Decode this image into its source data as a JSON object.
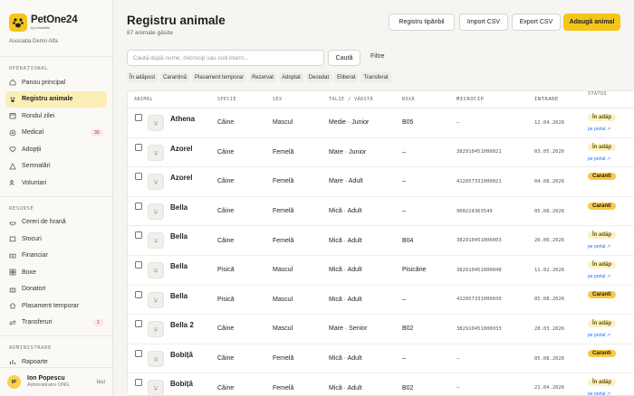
{
  "brand": {
    "name": "PetOne24",
    "sub": "by fundatiile"
  },
  "org": "Asociația Demo Alfa",
  "sidebar": {
    "sections": [
      {
        "label": "OPERAȚIONAL",
        "items": [
          {
            "label": "Panou principal",
            "icon": "home-icon"
          },
          {
            "label": "Registru animale",
            "icon": "paw-icon",
            "active": true
          },
          {
            "label": "Rondul zilei",
            "icon": "calendar-icon"
          },
          {
            "label": "Medical",
            "icon": "medical-icon",
            "badge": "36"
          },
          {
            "label": "Adopții",
            "icon": "heart-icon"
          },
          {
            "label": "Semnalări",
            "icon": "alert-icon"
          },
          {
            "label": "Voluntari",
            "icon": "users-icon"
          }
        ]
      },
      {
        "label": "RESURSE",
        "items": [
          {
            "label": "Cereri de hrană",
            "icon": "food-icon"
          },
          {
            "label": "Stocuri",
            "icon": "box-icon"
          },
          {
            "label": "Financiar",
            "icon": "money-icon"
          },
          {
            "label": "Boxe",
            "icon": "grid-icon"
          },
          {
            "label": "Donatori",
            "icon": "gift-icon"
          },
          {
            "label": "Plasament temporar",
            "icon": "house-icon"
          },
          {
            "label": "Transferuri",
            "icon": "transfer-icon",
            "badge": "1"
          }
        ]
      },
      {
        "label": "ADMINISTRARE",
        "items": [
          {
            "label": "Rapoarte",
            "icon": "chart-icon"
          }
        ]
      }
    ]
  },
  "user": {
    "initials": "IP",
    "name": "Ion Popescu",
    "role": "Administrator ONG",
    "logout": "Ieși"
  },
  "header": {
    "title": "Registru animale",
    "subtitle": "87 animale găsite",
    "buttons": {
      "print": "Registru tipăribil",
      "import": "Import CSV",
      "export": "Export CSV",
      "add": "Adaugă animal"
    }
  },
  "search": {
    "placeholder": "Caută după nume, microcip sau cod intern...",
    "button": "Caută",
    "filter": "Filtre"
  },
  "chips": [
    "În adăpost",
    "Carantină",
    "Plasament temporar",
    "Rezervat",
    "Adoptat",
    "Decedat",
    "Eliberat",
    "Transferat"
  ],
  "table": {
    "headers": [
      "ANIMAL",
      "SPECIE",
      "SEX",
      "TALIE / VÂRSTĂ",
      "BOXĂ",
      "MICROCIP",
      "INTRARE",
      "STATUS"
    ],
    "rows": [
      {
        "name": "Athena",
        "specie": "Câine",
        "sex": "Mascul",
        "talie": "Medie · Junior",
        "boxa": "B05",
        "microcip": "–",
        "intrare": "12.04.2026",
        "status": "În adăp",
        "status_type": "adapost",
        "portal": "pe portal ↗"
      },
      {
        "name": "Azorel",
        "specie": "Câine",
        "sex": "Femelă",
        "talie": "Mare · Junior",
        "boxa": "–",
        "microcip": "382910451000021",
        "intrare": "03.05.2026",
        "status": "În adăp",
        "status_type": "adapost",
        "portal": "pe portal ↗"
      },
      {
        "name": "Azorel",
        "specie": "Câine",
        "sex": "Femelă",
        "talie": "Mare · Adult",
        "boxa": "–",
        "microcip": "412057331000021",
        "intrare": "04.08.2026",
        "status": "Caranti",
        "status_type": "carantina",
        "portal": ""
      },
      {
        "name": "Bella",
        "specie": "Câine",
        "sex": "Femelă",
        "talie": "Mică · Adult",
        "boxa": "–",
        "microcip": "900224363549",
        "intrare": "05.08.2026",
        "status": "Caranti",
        "status_type": "carantina",
        "portal": ""
      },
      {
        "name": "Bella",
        "specie": "Câine",
        "sex": "Femelă",
        "talie": "Mică · Adult",
        "boxa": "B04",
        "microcip": "382910451000003",
        "intrare": "26.06.2026",
        "status": "În adăp",
        "status_type": "adapost",
        "portal": "pe portal ↗"
      },
      {
        "name": "Bella",
        "specie": "Pisică",
        "sex": "Mascul",
        "talie": "Mică · Adult",
        "boxa": "Pisicărie",
        "microcip": "382910451000048",
        "intrare": "11.02.2026",
        "status": "În adăp",
        "status_type": "adapost",
        "portal": "pe portal ↗"
      },
      {
        "name": "Bella",
        "specie": "Pisică",
        "sex": "Mascul",
        "talie": "Mică · Adult",
        "boxa": "–",
        "microcip": "412057331000030",
        "intrare": "05.08.2026",
        "status": "Caranti",
        "status_type": "carantina",
        "portal": ""
      },
      {
        "name": "Bella 2",
        "specie": "Câine",
        "sex": "Mascul",
        "talie": "Mare · Senior",
        "boxa": "B02",
        "microcip": "382910451000033",
        "intrare": "28.03.2026",
        "status": "În adăp",
        "status_type": "adapost",
        "portal": "pe portal ↗"
      },
      {
        "name": "Bobiță",
        "specie": "Câine",
        "sex": "Femelă",
        "talie": "Mică · Adult",
        "boxa": "–",
        "microcip": "–",
        "intrare": "05.08.2026",
        "status": "Caranti",
        "status_type": "carantina",
        "portal": ""
      },
      {
        "name": "Bobiță",
        "specie": "Câine",
        "sex": "Femelă",
        "talie": "Mică · Adult",
        "boxa": "B02",
        "microcip": "–",
        "intrare": "21.04.2026",
        "status": "În adăp",
        "status_type": "adapost",
        "portal": "pe portal ↗"
      }
    ]
  },
  "colors": {
    "accent": "#f5c518",
    "active_nav": "#fbeeb6",
    "badge_red": "#c0392b",
    "link": "#1f6feb"
  }
}
